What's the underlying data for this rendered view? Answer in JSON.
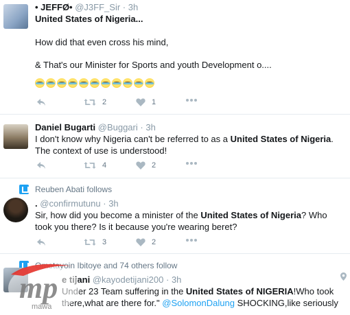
{
  "tweets": [
    {
      "name": "• JEFFØ•",
      "handle": "@J3FF_Sir",
      "time": "3h",
      "lines": {
        "l1": "United States of Nigeria...",
        "l2": "How did that even cross his mind,",
        "l3": "& That's our Minister for Sports and youth Development o...."
      },
      "emoji_count": 11,
      "retweets": "2",
      "likes": "1"
    },
    {
      "name": "Daniel Bugarti",
      "handle": "@Buggari",
      "time": "3h",
      "lines": {
        "l1a": "I don't know why Nigeria can't be referred to as a ",
        "l1b": "United States of Nigeria",
        "l1c": ".",
        "l2": "The context of use is understood!"
      },
      "retweets": "4",
      "likes": "2"
    },
    {
      "social_context": "Reuben Abati follows",
      "name": ".",
      "handle": "@confirmutunu",
      "time": "3h",
      "lines": {
        "l1a": "Sir, how did you become a minister of the ",
        "l1b": "United States of Nigeria",
        "l1c": "? Who",
        "l2": "took you there? Is it because you're wearing beret?"
      },
      "retweets": "3",
      "likes": "2"
    },
    {
      "social_context": "Omotayoin Ibitoye and 74 others follow",
      "name": "e tijani",
      "handle": "@kayodetijani200",
      "time": "3h",
      "lines": {
        "l1a": "Under 23 Team suffering in the ",
        "l1b": "United States of NIGERIA",
        "l1c": "!Who took",
        "l2a": "there,what are there for.\" ",
        "l2b": "@SolomonDalung",
        "l2c": " SHOCKING,like seriously"
      }
    }
  ],
  "icons": {
    "reply": "reply-icon",
    "retweet": "retweet-icon",
    "like": "heart-icon",
    "more": "more-dots-icon",
    "follow": "follow-icon",
    "geo": "location-pin-icon"
  },
  "watermark": {
    "text": "mp",
    "sub": "mawa"
  },
  "colors": {
    "link": "#1da1f2",
    "muted": "#8899a6",
    "icon": "#aab8c2"
  }
}
